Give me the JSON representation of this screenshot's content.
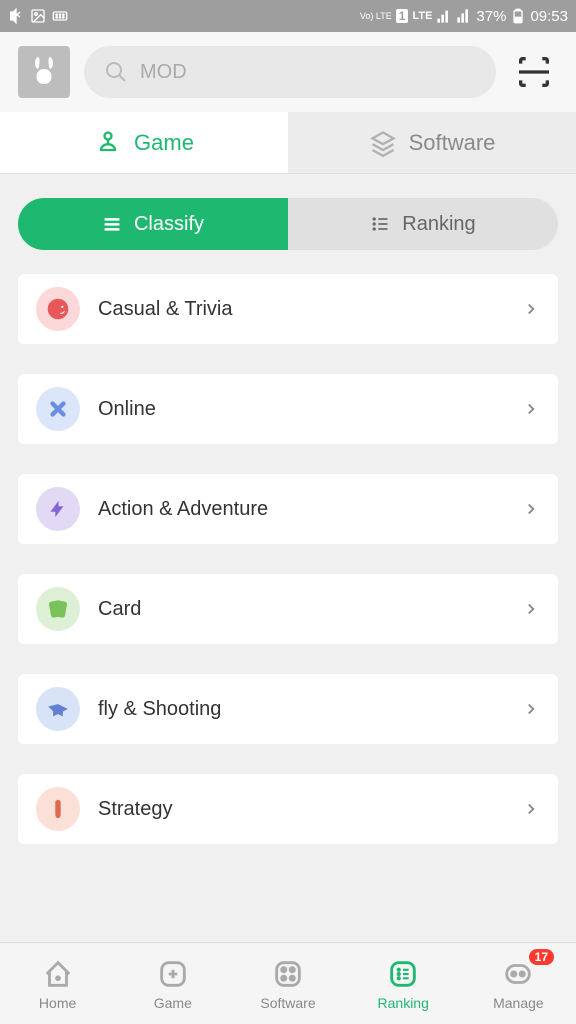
{
  "status_bar": {
    "volte": "Vo)\nLTE",
    "sim": "1",
    "lte": "LTE",
    "battery": "37%",
    "time": "09:53"
  },
  "search": {
    "placeholder": "MOD"
  },
  "main_tabs": [
    {
      "label": "Game",
      "active": true
    },
    {
      "label": "Software",
      "active": false
    }
  ],
  "sub_tabs": [
    {
      "label": "Classify",
      "active": true
    },
    {
      "label": "Ranking",
      "active": false
    }
  ],
  "categories": [
    {
      "label": "Casual & Trivia",
      "icon_bg": "#fcd8da",
      "icon_fg": "#e85858"
    },
    {
      "label": "Online",
      "icon_bg": "#dce6fb",
      "icon_fg": "#6a8de0"
    },
    {
      "label": "Action & Adventure",
      "icon_bg": "#e2daf5",
      "icon_fg": "#8366d4"
    },
    {
      "label": "Card",
      "icon_bg": "#ddf0d5",
      "icon_fg": "#7cc25c"
    },
    {
      "label": "fly & Shooting",
      "icon_bg": "#d8e3f7",
      "icon_fg": "#6380d2"
    },
    {
      "label": "Strategy",
      "icon_bg": "#fbe0d7",
      "icon_fg": "#e06a50"
    }
  ],
  "bottom_nav": [
    {
      "label": "Home"
    },
    {
      "label": "Game"
    },
    {
      "label": "Software"
    },
    {
      "label": "Ranking",
      "active": true
    },
    {
      "label": "Manage",
      "badge": "17"
    }
  ]
}
